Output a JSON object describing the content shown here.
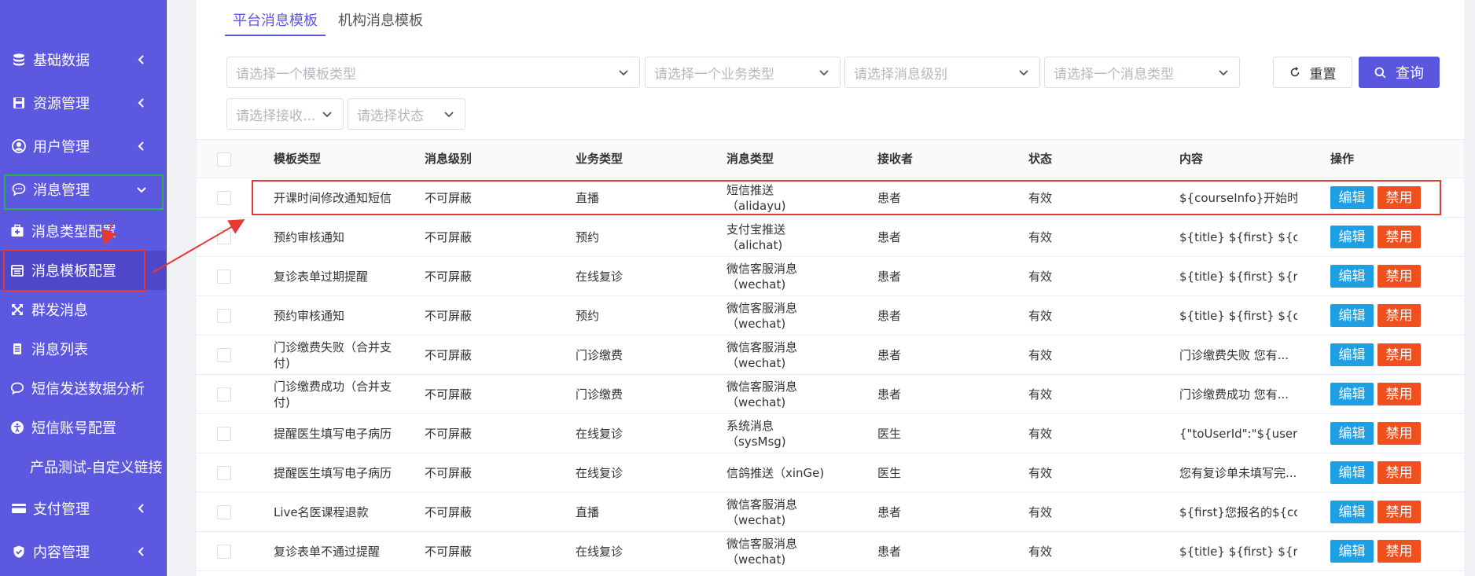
{
  "sidebar": {
    "items": [
      {
        "label": "基础数据",
        "icon": "database-icon"
      },
      {
        "label": "资源管理",
        "icon": "save-icon"
      },
      {
        "label": "用户管理",
        "icon": "user-icon"
      },
      {
        "label": "消息管理",
        "icon": "chat-icon"
      }
    ],
    "sub_items": [
      {
        "label": "消息类型配置",
        "icon": "medkit-icon"
      },
      {
        "label": "消息模板配置",
        "icon": "calendar-icon"
      },
      {
        "label": "群发消息",
        "icon": "expand-icon"
      },
      {
        "label": "消息列表",
        "icon": "list-icon"
      },
      {
        "label": "短信发送数据分析",
        "icon": "comment-icon"
      },
      {
        "label": "短信账号配置",
        "icon": "accessibility-icon"
      },
      {
        "label": "产品测试-自定义链接",
        "icon": ""
      }
    ],
    "bottom_items": [
      {
        "label": "支付管理",
        "icon": "credit-card-icon"
      },
      {
        "label": "内容管理",
        "icon": "shield-check-icon"
      }
    ]
  },
  "tabs": [
    {
      "label": "平台消息模板"
    },
    {
      "label": "机构消息模板"
    }
  ],
  "filters": {
    "template_type": "请选择一个模板类型",
    "business_type": "请选择一个业务类型",
    "message_level": "请选择消息级别",
    "message_type": "请选择一个消息类型",
    "receiver": "请选择接收...",
    "status": "请选择状态",
    "reset_label": "重置",
    "query_label": "查询"
  },
  "table": {
    "headers": [
      "模板类型",
      "消息级别",
      "业务类型",
      "消息类型",
      "接收者",
      "状态",
      "内容",
      "操作"
    ],
    "edit_label": "编辑",
    "disable_label": "禁用",
    "rows": [
      {
        "type": "开课时间修改通知短信",
        "level": "不可屏蔽",
        "biz": "直播",
        "msg": "短信推送（alidayu)",
        "recv": "患者",
        "status": "有效",
        "content": "${courseInfo}开始时..."
      },
      {
        "type": "预约审核通知",
        "level": "不可屏蔽",
        "biz": "预约",
        "msg": "支付宝推送（alichat)",
        "recv": "患者",
        "status": "有效",
        "content": "${title} ${first} ${cont..."
      },
      {
        "type": "复诊表单过期提醒",
        "level": "不可屏蔽",
        "biz": "在线复诊",
        "msg": "微信客服消息（wechat)",
        "recv": "患者",
        "status": "有效",
        "content": "${title} ${first} ${rem..."
      },
      {
        "type": "预约审核通知",
        "level": "不可屏蔽",
        "biz": "预约",
        "msg": "微信客服消息（wechat)",
        "recv": "患者",
        "status": "有效",
        "content": "${title} ${first} ${cont..."
      },
      {
        "type": "门诊缴费失败（合并支付)",
        "level": "不可屏蔽",
        "biz": "门诊缴费",
        "msg": "微信客服消息（wechat)",
        "recv": "患者",
        "status": "有效",
        "content": "门诊缴费失败 您有..."
      },
      {
        "type": "门诊缴费成功（合并支付)",
        "level": "不可屏蔽",
        "biz": "门诊缴费",
        "msg": "微信客服消息（wechat)",
        "recv": "患者",
        "status": "有效",
        "content": "门诊缴费成功 您有..."
      },
      {
        "type": "提醒医生填写电子病历",
        "level": "不可屏蔽",
        "biz": "在线复诊",
        "msg": "系统消息（sysMsg)",
        "recv": "医生",
        "status": "有效",
        "content": "{\"toUserId\":\"${userId..."
      },
      {
        "type": "提醒医生填写电子病历",
        "level": "不可屏蔽",
        "biz": "在线复诊",
        "msg": "信鸽推送（xinGe)",
        "recv": "医生",
        "status": "有效",
        "content": "您有复诊单未填写完..."
      },
      {
        "type": "Live名医课程退款",
        "level": "不可屏蔽",
        "biz": "直播",
        "msg": "微信客服消息（wechat)",
        "recv": "患者",
        "status": "有效",
        "content": "${first}您报名的${co..."
      },
      {
        "type": "复诊表单不通过提醒",
        "level": "不可屏蔽",
        "biz": "在线复诊",
        "msg": "微信客服消息（wechat)",
        "recv": "患者",
        "status": "有效",
        "content": "${title} ${first} ${rem..."
      }
    ]
  },
  "colors": {
    "sidebar_bg": "#5d58e0",
    "primary": "#5b56de",
    "edit": "#1e9fe4",
    "disable": "#f0501e",
    "annotation_red": "#e53935",
    "annotation_green": "#2bb24c"
  }
}
